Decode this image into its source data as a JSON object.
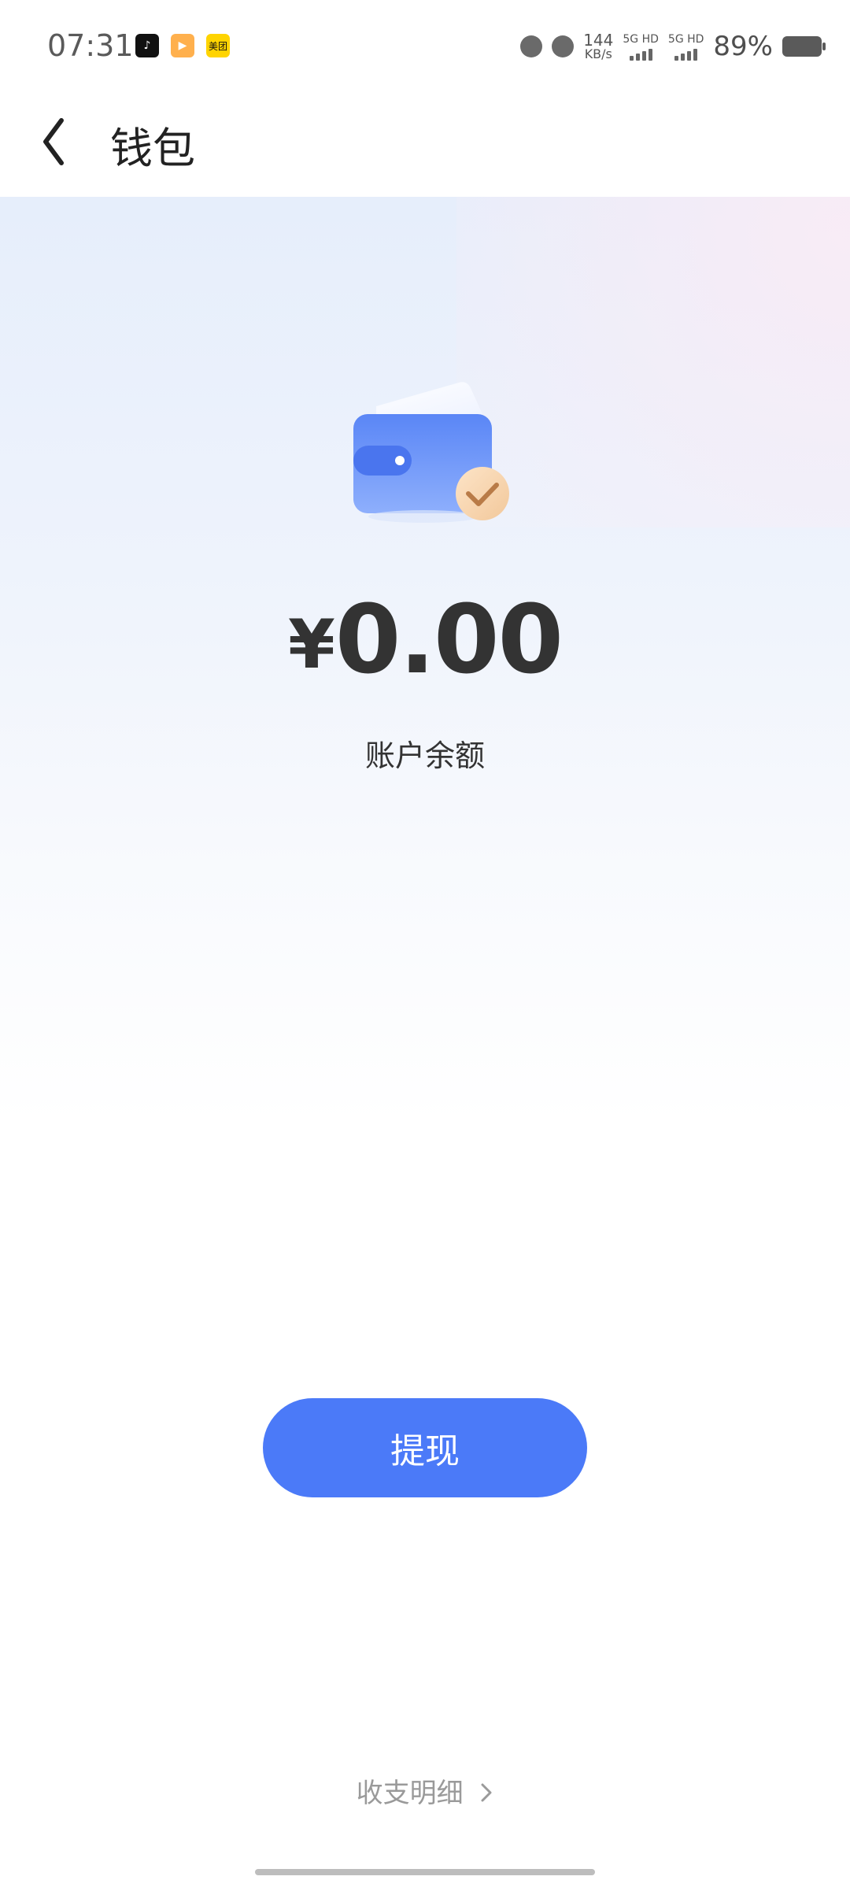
{
  "status_bar": {
    "time": "07:31",
    "apps": [
      {
        "icon": "douyin-icon",
        "glyph": "♪"
      },
      {
        "icon": "video-app-icon",
        "glyph": "▶"
      },
      {
        "icon": "meituan-icon",
        "glyph": "美团"
      }
    ],
    "icons": [
      "alarm-icon",
      "mute-icon"
    ],
    "network_speed": "144",
    "network_unit": "KB/s",
    "signal_1": "5G HD",
    "signal_2": "5G HD",
    "battery": "89%"
  },
  "header": {
    "title": "钱包"
  },
  "wallet": {
    "currency_symbol": "¥",
    "balance": "0.00",
    "balance_label": "账户余额"
  },
  "actions": {
    "withdraw": "提现",
    "detail": "收支明细"
  },
  "colors": {
    "accent": "#4b7af8",
    "wallet_blue": "#5a86f6",
    "check_badge": "#f2c89b"
  }
}
